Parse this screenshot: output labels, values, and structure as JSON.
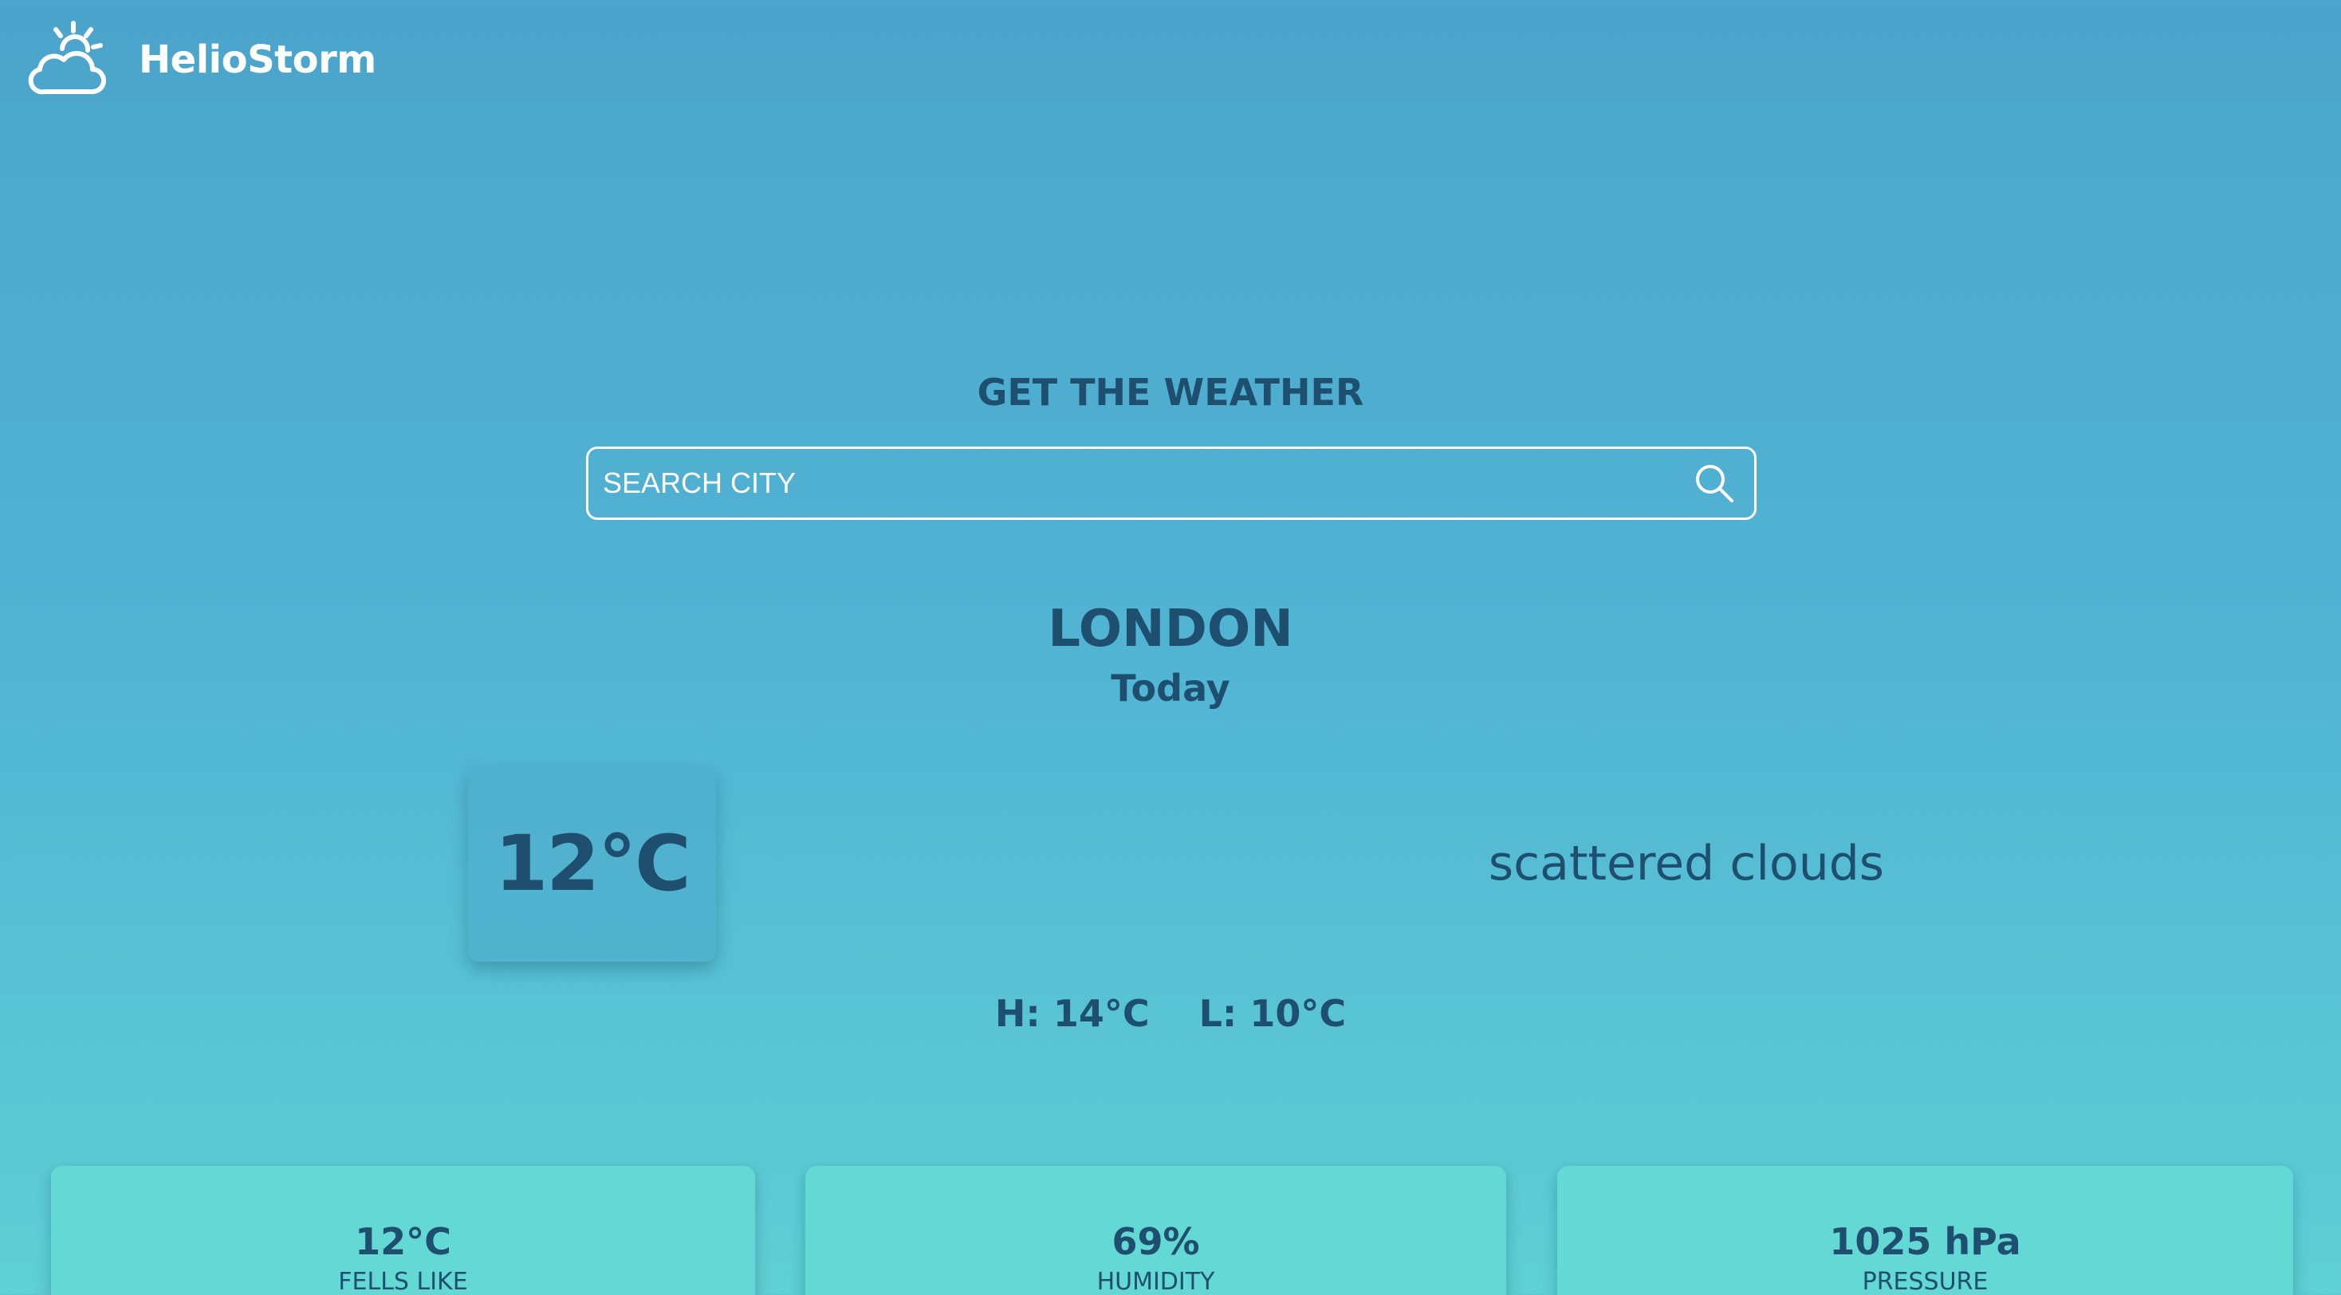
{
  "header": {
    "brand_name": "HelioStorm",
    "logo_icon": "cloud-sun-icon"
  },
  "search": {
    "title": "GET THE WEATHER",
    "placeholder": "SEARCH CITY",
    "value": "",
    "icon": "search-icon"
  },
  "location": {
    "city": "LONDON",
    "day": "Today"
  },
  "current": {
    "temperature": "12°C",
    "condition": "scattered clouds",
    "high": "H: 14°C",
    "low": "L: 10°C"
  },
  "stats": [
    {
      "value": "12°C",
      "label": "FELLS LIKE"
    },
    {
      "value": "69%",
      "label": "HUMIDITY"
    },
    {
      "value": "1025 hPa",
      "label": "PRESSURE"
    }
  ],
  "colors": {
    "background_top": "#4ba4cb",
    "background_bottom": "#5fd0d4",
    "text_primary": "#1f4f6e",
    "brand_text": "#ffffff",
    "card_bottom": "#64d8d4"
  }
}
